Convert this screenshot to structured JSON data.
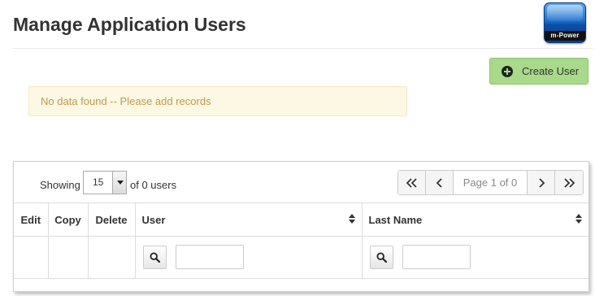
{
  "header": {
    "title": "Manage Application Users",
    "logo_text": "m-Power"
  },
  "toolbar": {
    "create_label": "Create User"
  },
  "alert": {
    "message": "No data found -- Please add records"
  },
  "list": {
    "showing_label": "Showing",
    "page_size": "15",
    "count_label": "of 0 users",
    "pager": {
      "first": "«",
      "prev": "‹",
      "info": "Page 1 of 0",
      "next": "›",
      "last": "»"
    },
    "columns": [
      {
        "label": "Edit"
      },
      {
        "label": "Copy"
      },
      {
        "label": "Delete"
      },
      {
        "label": "User"
      },
      {
        "label": "Last Name"
      }
    ],
    "filters": {
      "user_value": "",
      "last_name_value": ""
    }
  },
  "colors": {
    "create_button": "#a9d98b",
    "alert_bg": "#fcf8e3",
    "alert_text": "#c09853",
    "logo_blue": "#1f6fcb"
  },
  "icons": {
    "create": "plus-circle-icon",
    "search": "search-icon",
    "sort": "sort-icon",
    "dropdown": "caret-down-icon"
  }
}
